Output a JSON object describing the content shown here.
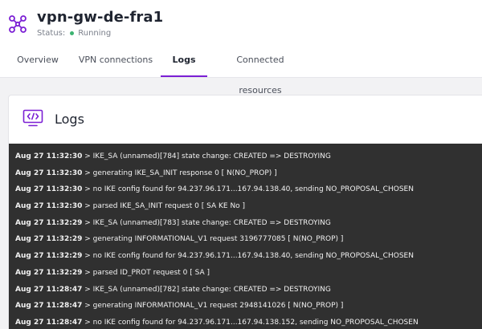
{
  "header": {
    "title": "vpn-gw-de-fra1",
    "status_label": "Status:",
    "status_value": "Running",
    "status_color": "#3cb371",
    "icon": "network-nodes-icon",
    "accent_color": "#7b1fd4"
  },
  "tabs": [
    {
      "label": "Overview",
      "active": false
    },
    {
      "label": "VPN connections",
      "active": false
    },
    {
      "label": "Logs",
      "active": true
    },
    {
      "label": "Connected resources",
      "active": false
    }
  ],
  "panel": {
    "title": "Logs",
    "icon": "code-monitor-icon"
  },
  "logs": [
    {
      "ts": "Aug 27 11:32:30",
      "msg": "IKE_SA (unnamed)[784] state change: CREATED => DESTROYING"
    },
    {
      "ts": "Aug 27 11:32:30",
      "msg": "generating IKE_SA_INIT response 0 [ N(NO_PROP) ]"
    },
    {
      "ts": "Aug 27 11:32:30",
      "msg": "no IKE config found for 94.237.96.171...167.94.138.40, sending NO_PROPOSAL_CHOSEN"
    },
    {
      "ts": "Aug 27 11:32:30",
      "msg": "parsed IKE_SA_INIT request 0 [ SA KE No ]"
    },
    {
      "ts": "Aug 27 11:32:29",
      "msg": "IKE_SA (unnamed)[783] state change: CREATED => DESTROYING"
    },
    {
      "ts": "Aug 27 11:32:29",
      "msg": "generating INFORMATIONAL_V1 request 3196777085 [ N(NO_PROP) ]"
    },
    {
      "ts": "Aug 27 11:32:29",
      "msg": "no IKE config found for 94.237.96.171...167.94.138.40, sending NO_PROPOSAL_CHOSEN"
    },
    {
      "ts": "Aug 27 11:32:29",
      "msg": "parsed ID_PROT request 0 [ SA ]"
    },
    {
      "ts": "Aug 27 11:28:47",
      "msg": "IKE_SA (unnamed)[782] state change: CREATED => DESTROYING"
    },
    {
      "ts": "Aug 27 11:28:47",
      "msg": "generating INFORMATIONAL_V1 request 2948141026 [ N(NO_PROP) ]"
    },
    {
      "ts": "Aug 27 11:28:47",
      "msg": "no IKE config found for 94.237.96.171...167.94.138.152, sending NO_PROPOSAL_CHOSEN"
    }
  ]
}
